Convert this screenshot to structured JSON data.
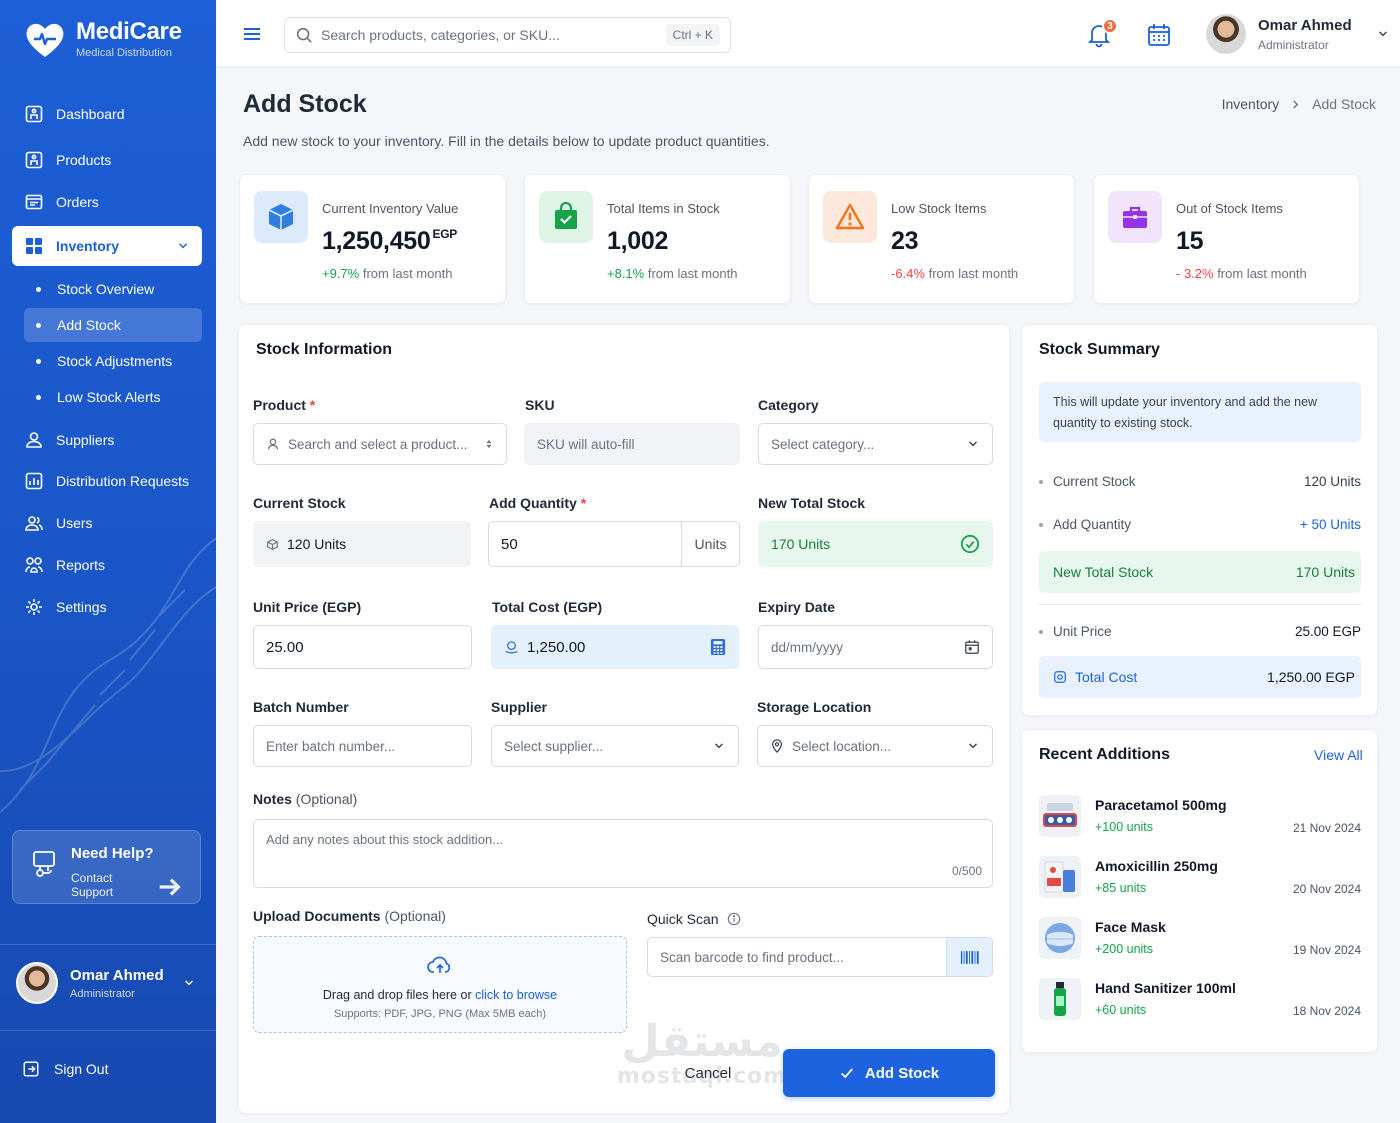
{
  "brand": {
    "name": "MediCare",
    "tagline": "Medical Distribution"
  },
  "sidebar": {
    "items": [
      {
        "label": "Dashboard",
        "icon": "dashboard-icon"
      },
      {
        "label": "Products",
        "icon": "products-icon"
      },
      {
        "label": "Orders",
        "icon": "orders-icon"
      },
      {
        "label": "Inventory",
        "icon": "grid-icon",
        "active": true
      },
      {
        "label": "Suppliers",
        "icon": "suppliers-icon"
      },
      {
        "label": "Distribution Requests",
        "icon": "distribution-icon"
      },
      {
        "label": "Users",
        "icon": "users-icon"
      },
      {
        "label": "Reports",
        "icon": "reports-icon"
      },
      {
        "label": "Settings",
        "icon": "settings-icon"
      }
    ],
    "inventory_sub": [
      "Stock Overview",
      "Add Stock",
      "Stock Adjustments",
      "Low Stock Alerts"
    ],
    "help": {
      "title": "Need Help?",
      "link": "Contact Support"
    },
    "user": {
      "name": "Omar Ahmed",
      "role": "Administrator"
    },
    "signout": "Sign Out"
  },
  "topbar": {
    "search_placeholder": "Search products, categories, or SKU...",
    "shortcut": "Ctrl + K",
    "notifications": "3",
    "user": {
      "name": "Omar Ahmed",
      "role": "Administrator"
    }
  },
  "page": {
    "title": "Add Stock",
    "subtitle": "Add new stock to your inventory. Fill in the details below to update product quantities.",
    "breadcrumb": [
      "Inventory",
      "Add Stock"
    ]
  },
  "stats": [
    {
      "label": "Current Inventory Value",
      "value": "1,250,450",
      "unit": "EGP",
      "change": "+9.7%",
      "change_suffix": " from last month",
      "trend": "up",
      "color": "#2f7fe0"
    },
    {
      "label": "Total Items in Stock",
      "value": "1,002",
      "unit": "",
      "change": "+8.1%",
      "change_suffix": " from last month",
      "trend": "up",
      "color": "#16a34a"
    },
    {
      "label": "Low Stock Items",
      "value": "23",
      "unit": "",
      "change": "-6.4%",
      "change_suffix": " from last month",
      "trend": "down",
      "color": "#f97316"
    },
    {
      "label": "Out of Stock Items",
      "value": "15",
      "unit": "",
      "change": "- 3.2%",
      "change_suffix": " from last month",
      "trend": "down",
      "color": "#9333ea"
    }
  ],
  "form": {
    "title": "Stock Information",
    "product": {
      "label": "Product",
      "placeholder": "Search and select a product..."
    },
    "sku": {
      "label": "SKU",
      "placeholder": "SKU will auto-fill"
    },
    "category": {
      "label": "Category",
      "placeholder": "Select category..."
    },
    "current_stock": {
      "label": "Current Stock",
      "value": "120 Units"
    },
    "add_quantity": {
      "label": "Add Quantity",
      "value": "50",
      "unit": "Units"
    },
    "new_total": {
      "label": "New Total Stock",
      "value": "170 Units"
    },
    "unit_price": {
      "label": "Unit Price (EGP)",
      "value": "25.00"
    },
    "total_cost": {
      "label": "Total Cost (EGP)",
      "value": "1,250.00"
    },
    "expiry": {
      "label": "Expiry Date",
      "placeholder": "dd/mm/yyyy"
    },
    "batch": {
      "label": "Batch Number",
      "placeholder": "Enter batch number..."
    },
    "supplier": {
      "label": "Supplier",
      "placeholder": "Select supplier..."
    },
    "location": {
      "label": "Storage Location",
      "placeholder": "Select location..."
    },
    "notes": {
      "label": "Notes",
      "optional": "(Optional)",
      "placeholder": "Add any notes about this stock addition...",
      "count": "0/500"
    },
    "upload": {
      "label": "Upload Documents",
      "optional": "(Optional)",
      "text": "Drag and drop files here or",
      "link": "click to browse",
      "hint": "Supports: PDF, JPG, PNG (Max 5MB each)"
    },
    "scan": {
      "label": "Quick Scan",
      "placeholder": "Scan barcode to find product..."
    },
    "cancel": "Cancel",
    "submit": "Add Stock"
  },
  "summary": {
    "title": "Stock Summary",
    "note": "This will update your inventory and add the new quantity to existing stock.",
    "current_stock": {
      "label": "Current Stock",
      "value": "120 Units"
    },
    "add_quantity": {
      "label": "Add Quantity",
      "value": "+ 50 Units"
    },
    "new_total": {
      "label": "New Total Stock",
      "value": "170 Units"
    },
    "unit_price": {
      "label": "Unit Price",
      "value": "25.00 EGP"
    },
    "total_cost": {
      "label": "Total Cost",
      "value": "1,250.00 EGP"
    }
  },
  "recent": {
    "title": "Recent Additions",
    "view_all": "View All",
    "items": [
      {
        "name": "Paracetamol 500mg",
        "qty": "+100 units",
        "date": "21 Nov 2024"
      },
      {
        "name": "Amoxicillin 250mg",
        "qty": "+85 units",
        "date": "20 Nov 2024"
      },
      {
        "name": "Face Mask",
        "qty": "+200 units",
        "date": "19 Nov 2024"
      },
      {
        "name": "Hand Sanitizer 100ml",
        "qty": "+60 units",
        "date": "18 Nov 2024"
      }
    ]
  },
  "watermark": {
    "arabic": "مستقل",
    "latin": "mostaql.com"
  }
}
